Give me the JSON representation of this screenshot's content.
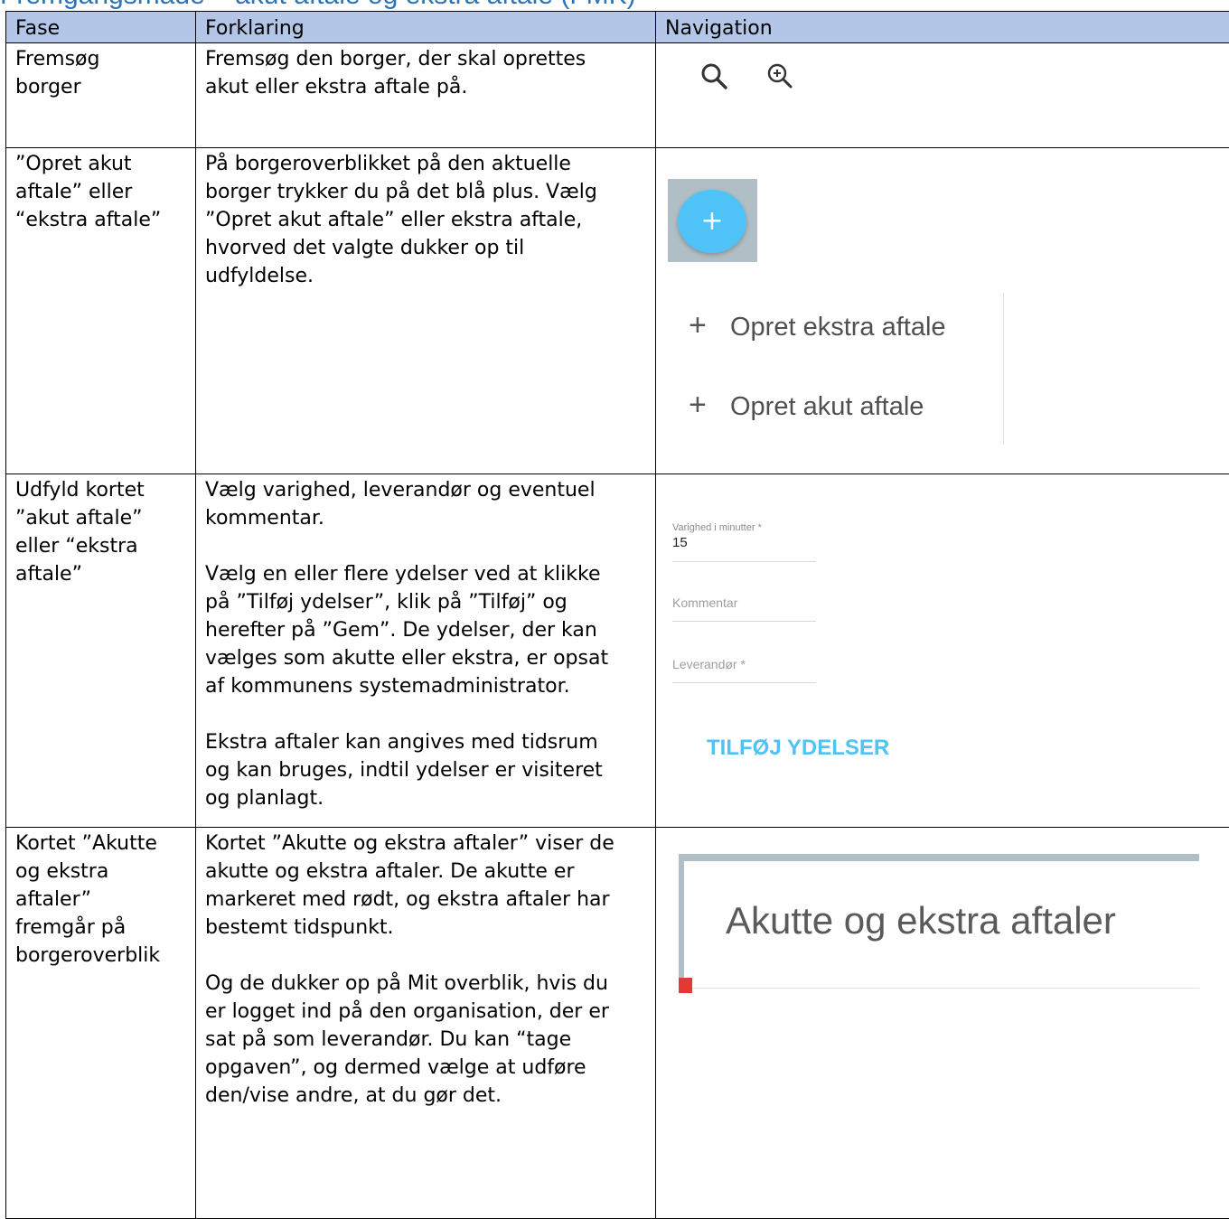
{
  "heading": "Fremgangsmåde – akut aftale og ekstra aftale (FMK)",
  "table": {
    "headers": [
      "Fase",
      "Forklaring",
      "Navigation"
    ],
    "rows": [
      {
        "phase": "Fremsøg\nborger",
        "explanation": "Fremsøg den borger, der skal oprettes\nakut eller ekstra aftale på."
      },
      {
        "phase": "”Opret akut\naftale” eller\n“ekstra aftale”",
        "explanation": "På borgeroverblikket på den aktuelle\nborger trykker du på det blå plus. Vælg\n”Opret akut aftale” eller ekstra aftale,\nhvorved det valgte dukker op til\nudfyldelse."
      },
      {
        "phase": "Udfyld kortet\n”akut aftale”\neller “ekstra\naftale”",
        "explanation": "Vælg varighed, leverandør og eventuel\nkommentar.\n\nVælg en eller flere ydelser ved at klikke\npå ”Tilføj ydelser”, klik på ”Tilføj” og\nherefter på ”Gem”. De ydelser, der kan\nvælges som akutte eller ekstra, er opsat\naf kommunens systemadministrator.\n\nEkstra aftaler kan angives med tidsrum\nog kan bruges, indtil ydelser er visiteret\nog planlagt."
      },
      {
        "phase": "Kortet ”Akutte\nog ekstra\naftaler”\nfremgår på\nborgeroverblik",
        "explanation": "Kortet ”Akutte og ekstra aftaler” viser de\nakutte og ekstra aftaler. De akutte er\nmarkeret med rødt, og ekstra aftaler har\nbestemt tidspunkt.\n\nOg de dukker op på Mit overblik, hvis du\ner logget ind på den organisation, der er\nsat på som leverandør. Du kan “tage\nopgaven”, og dermed vælge at udføre\nden/vise andre, at du gør det."
      }
    ]
  },
  "nav": {
    "icons": [
      "search-icon",
      "zoom-in-icon"
    ],
    "fab_symbol": "+",
    "menu": [
      "Opret ekstra aftale",
      "Opret akut aftale"
    ],
    "form": {
      "duration_label": "Varighed i minutter *",
      "duration_value": "15",
      "comment_label": "Kommentar",
      "provider_label": "Leverandør *",
      "add_services": "TILFØJ YDELSER"
    },
    "card_title": "Akutte og ekstra aftaler"
  },
  "colors": {
    "header_bg": "#b4c6e7",
    "heading": "#2e74b5",
    "fab": "#4fc3f7",
    "accent_text": "#4fc3f7",
    "urgent_marker": "#e53935"
  }
}
